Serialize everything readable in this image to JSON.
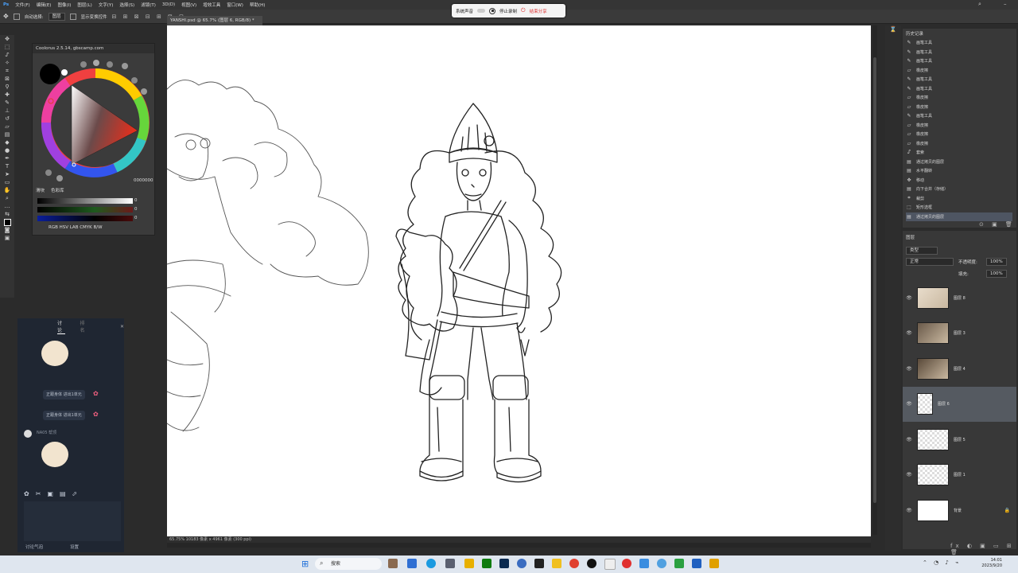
{
  "menu": {
    "items": [
      "文件(F)",
      "编辑(E)",
      "图像(I)",
      "图层(L)",
      "文字(Y)",
      "选择(S)",
      "滤镜(T)",
      "3D(D)",
      "视图(V)",
      "增效工具",
      "窗口(W)",
      "帮助(H)"
    ]
  },
  "options": {
    "auto_select_label": "自动选择:",
    "auto_select_value": "图层",
    "show_transform_label": "显示变换控件"
  },
  "recording": {
    "system_sound": "系统声音",
    "stop": "停止录制",
    "end_share": "结束分享"
  },
  "document": {
    "tab_title": "YANSHI.psd @ 65.7% (图层 6, RGB/8) *",
    "status": "65.75%   10183 像素 x 4961 像素 (300 ppi)"
  },
  "color_panel": {
    "title": "Coolorus 2.5.14, gbscamp.com",
    "tabs": [
      "滑块",
      "色彩库"
    ],
    "modes": "RGB  HSV  LAB  CMYK  B/W",
    "values": [
      "0",
      "0",
      "0"
    ],
    "brush_value": "0000000",
    "accent": "#e04030"
  },
  "chat": {
    "tabs": [
      "讨论",
      "排名"
    ],
    "messages": [
      "正跟身体 进出1单元",
      "正跟身体 进出1单元"
    ],
    "user": "NA05 帮顶",
    "footer_left": "讨论气泡",
    "footer_right": "设置"
  },
  "history": {
    "tab": "历史记录",
    "items": [
      {
        "icon": "brush-icon",
        "label": "画笔工具"
      },
      {
        "icon": "brush-icon",
        "label": "画笔工具"
      },
      {
        "icon": "brush-icon",
        "label": "画笔工具"
      },
      {
        "icon": "eraser-icon",
        "label": "橡皮擦"
      },
      {
        "icon": "brush-icon",
        "label": "画笔工具"
      },
      {
        "icon": "brush-icon",
        "label": "画笔工具"
      },
      {
        "icon": "eraser-icon",
        "label": "橡皮擦"
      },
      {
        "icon": "eraser-icon",
        "label": "橡皮擦"
      },
      {
        "icon": "brush-icon",
        "label": "画笔工具"
      },
      {
        "icon": "eraser-icon",
        "label": "橡皮擦"
      },
      {
        "icon": "eraser-icon",
        "label": "橡皮擦"
      },
      {
        "icon": "eraser-icon",
        "label": "橡皮擦"
      },
      {
        "icon": "lasso-icon",
        "label": "套索"
      },
      {
        "icon": "layer-icon",
        "label": "通过拷贝的图层"
      },
      {
        "icon": "layer-icon",
        "label": "水平翻转"
      },
      {
        "icon": "move-icon",
        "label": "移动"
      },
      {
        "icon": "layer-icon",
        "label": "向下合并（存储）"
      },
      {
        "icon": "crop-icon",
        "label": "裁剪"
      },
      {
        "icon": "marquee-icon",
        "label": "矩形选框"
      },
      {
        "icon": "layer-icon",
        "label": "通过拷贝的图层"
      }
    ]
  },
  "layers": {
    "tab": "图层",
    "kind": "类型",
    "blend_mode": "正常",
    "opacity_label": "不透明度:",
    "opacity": "100%",
    "fill_label": "填充:",
    "fill": "100%",
    "items": [
      {
        "name": "图层 8",
        "thumb": "photo"
      },
      {
        "name": "图层 3",
        "thumb": "photo"
      },
      {
        "name": "图层 4",
        "thumb": "photo"
      },
      {
        "name": "图层 6",
        "thumb": "sketch"
      },
      {
        "name": "图层 5",
        "thumb": "checker"
      },
      {
        "name": "图层 1",
        "thumb": "checker"
      },
      {
        "name": "背景",
        "thumb": "white"
      }
    ]
  },
  "taskbar": {
    "search": "搜索",
    "time": "14:01",
    "date": "2023/9/20"
  }
}
